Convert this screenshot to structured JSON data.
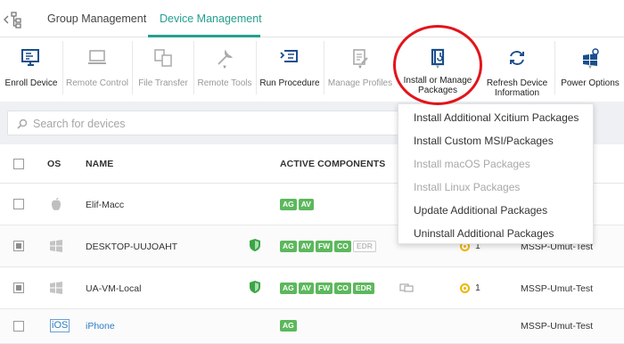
{
  "tabs": [
    {
      "label": "Group Management",
      "active": false
    },
    {
      "label": "Device Management",
      "active": true
    }
  ],
  "toolbar": [
    {
      "label": "Enroll Device",
      "enabled": true,
      "icon": "enroll-device-icon"
    },
    {
      "label": "Remote Control",
      "enabled": false,
      "icon": "monitor-icon"
    },
    {
      "label": "File Transfer",
      "enabled": false,
      "icon": "file-transfer-icon"
    },
    {
      "label": "Remote Tools",
      "enabled": false,
      "icon": "remote-tools-icon"
    },
    {
      "label": "Run Procedure",
      "enabled": true,
      "icon": "run-procedure-icon"
    },
    {
      "label": "Manage Profiles",
      "enabled": false,
      "icon": "manage-profiles-icon"
    },
    {
      "label": "Install or Manage Packages",
      "enabled": true,
      "icon": "package-icon"
    },
    {
      "label": "Refresh Device Information",
      "enabled": true,
      "icon": "refresh-icon"
    },
    {
      "label": "Power Options",
      "enabled": true,
      "icon": "power-options-icon"
    }
  ],
  "search": {
    "placeholder": "Search for devices"
  },
  "table": {
    "headers": {
      "os": "OS",
      "name": "NAME",
      "components": "ACTIVE COMPONENTS"
    },
    "rows": [
      {
        "os": "apple-icon",
        "name": "Elif-Macc",
        "checked": false,
        "components": [
          "AG",
          "AV"
        ],
        "components_off": [],
        "shield": false,
        "alerts": "",
        "customer": ""
      },
      {
        "os": "windows-icon",
        "name": "DESKTOP-UUJOAHT",
        "checked": true,
        "components": [
          "AG",
          "AV",
          "FW",
          "CO"
        ],
        "components_off": [
          "EDR"
        ],
        "shield": true,
        "alerts": "1",
        "customer": "MSSP-Umut-Test"
      },
      {
        "os": "windows-icon",
        "name": "UA-VM-Local",
        "checked": true,
        "components": [
          "AG",
          "AV",
          "FW",
          "CO",
          "EDR"
        ],
        "components_off": [],
        "shield": true,
        "alerts": "1",
        "customer": "MSSP-Umut-Test"
      },
      {
        "os": "ios-icon",
        "os_label": "iOS",
        "name": "iPhone",
        "checked": false,
        "components": [
          "AG"
        ],
        "components_off": [],
        "shield": false,
        "alerts": "",
        "customer": "MSSP-Umut-Test"
      }
    ]
  },
  "dropdown": {
    "items": [
      {
        "label": "Install Additional Xcitium Packages",
        "enabled": true
      },
      {
        "label": "Install Custom MSI/Packages",
        "enabled": true
      },
      {
        "label": "Install macOS Packages",
        "enabled": false
      },
      {
        "label": "Install Linux Packages",
        "enabled": false
      },
      {
        "label": "Update Additional Packages",
        "enabled": true
      },
      {
        "label": "Uninstall Additional Packages",
        "enabled": true
      }
    ]
  },
  "colors": {
    "accent": "#24a08e",
    "highlight_circle": "#e2141b",
    "badge_green": "#5cb85c",
    "alert_yellow": "#f0b400",
    "link_blue": "#2c7dc5"
  }
}
